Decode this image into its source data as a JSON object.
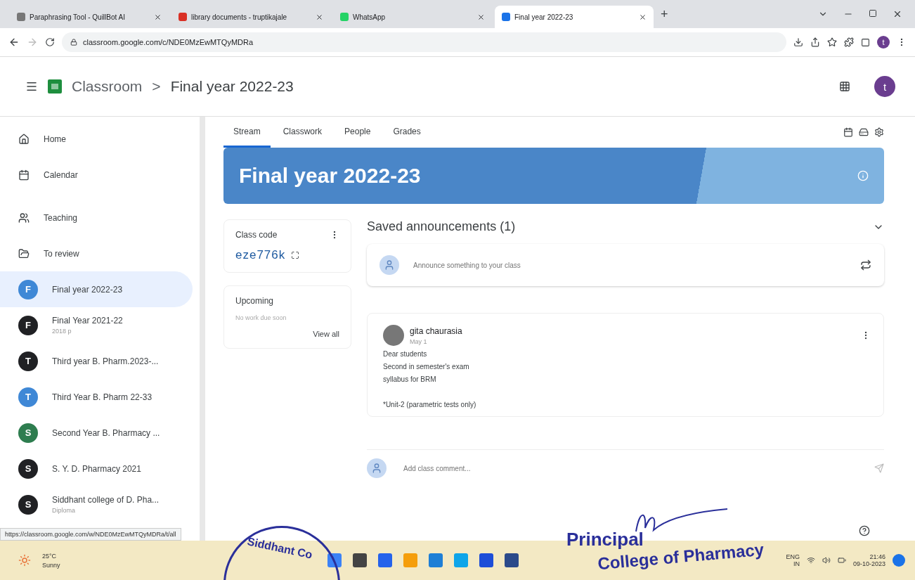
{
  "browser": {
    "tabs": [
      {
        "title": "Paraphrasing Tool - QuillBot AI",
        "selected": false
      },
      {
        "title": "library documents - truptikajale",
        "selected": false
      },
      {
        "title": "WhatsApp",
        "selected": false
      },
      {
        "title": "Final year 2022-23",
        "selected": true
      }
    ],
    "new_tab": "+",
    "url": "classroom.google.com/c/NDE0MzEwMTQyMDRa",
    "profile": "t"
  },
  "header": {
    "app": "Classroom",
    "separator": ">",
    "class_name": "Final year 2022-23",
    "avatar": "t"
  },
  "sidebar": {
    "items": [
      {
        "kind": "nav",
        "label": "Home",
        "selected": false
      },
      {
        "kind": "nav",
        "label": "Calendar",
        "selected": false
      },
      {
        "kind": "section",
        "label": "Teaching",
        "selected": false
      },
      {
        "kind": "nav",
        "label": "To review",
        "selected": false
      },
      {
        "kind": "class",
        "label": "Final year 2022-23",
        "initial": "F",
        "color": "#3f88d6",
        "selected": true
      },
      {
        "kind": "class",
        "label": "Final Year 2021-22",
        "subtitle": "2018 p",
        "initial": "F",
        "color": "#202124",
        "selected": false
      },
      {
        "kind": "class",
        "label": "Third year B. Pharm.2023-...",
        "initial": "T",
        "color": "#202124",
        "selected": false
      },
      {
        "kind": "class",
        "label": "Third Year B. Pharm 22-33",
        "initial": "T",
        "color": "#3f88d6",
        "selected": false
      },
      {
        "kind": "class",
        "label": "Second Year B. Pharmacy ...",
        "initial": "S",
        "color": "#2e7d4f",
        "selected": false
      },
      {
        "kind": "class",
        "label": "S. Y. D. Pharmacy 2021",
        "initial": "S",
        "color": "#202124",
        "selected": false
      },
      {
        "kind": "class",
        "label": "Siddhant college of D. Pha...",
        "subtitle": "Diploma",
        "initial": "S",
        "color": "#202124",
        "selected": false
      }
    ]
  },
  "tabs": [
    {
      "label": "Stream",
      "selected": true
    },
    {
      "label": "Classwork",
      "selected": false
    },
    {
      "label": "People",
      "selected": false
    },
    {
      "label": "Grades",
      "selected": false
    }
  ],
  "banner": {
    "title": "Final year 2022-23"
  },
  "class_code": {
    "label": "Class code",
    "code": "eze776k"
  },
  "upcoming": {
    "title": "Upcoming",
    "message": "No work due soon",
    "link": "View all"
  },
  "saved": {
    "title": "Saved announcements (1)"
  },
  "composer": {
    "placeholder": "Announce something to your class"
  },
  "post": {
    "author": "gita chaurasia",
    "date": "May 1",
    "paragraphs": [
      [
        "Dear students",
        "Second in semester's exam",
        "syllabus for BRM"
      ],
      [
        "*Unit-2 (parametric tests only)"
      ]
    ],
    "comment_placeholder": "Add class comment..."
  },
  "status_url": "https://classroom.google.com/w/NDE0MzEwMTQyMDRa/t/all",
  "taskbar": {
    "temperature": "25°C",
    "weather": "Sunny",
    "language": "ENG",
    "region": "IN",
    "time": "21:46",
    "date": "09-10-2023"
  },
  "stamp": {
    "seal": "Siddhant Co",
    "title": "Principal",
    "institution": "College of Pharmacy"
  }
}
